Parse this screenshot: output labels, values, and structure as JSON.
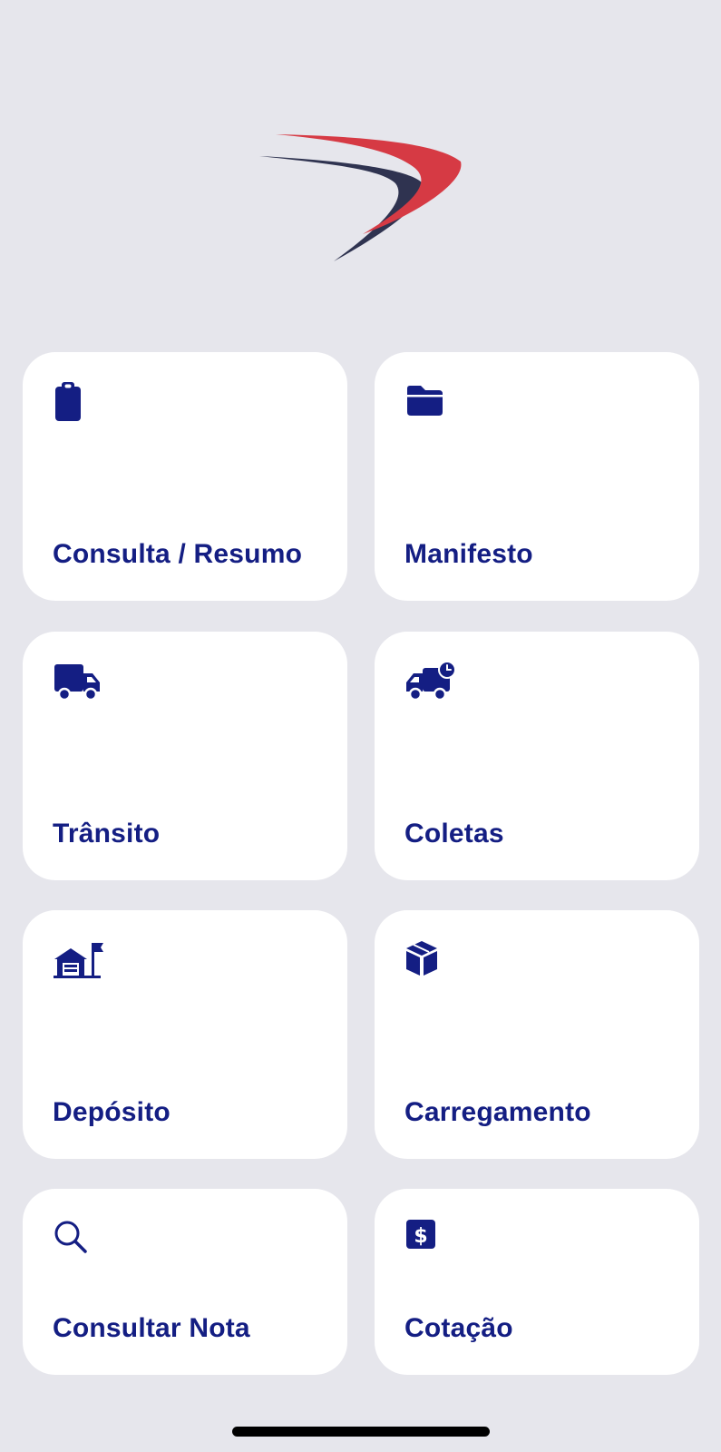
{
  "colors": {
    "background": "#e6e6ec",
    "card": "#ffffff",
    "accent": "#141e83",
    "logo_red": "#d63a44",
    "logo_navy": "#2f3350"
  },
  "logo": {
    "icon": "brand-swoosh-logo"
  },
  "menu": {
    "items": [
      {
        "label": "Consulta / Resumo",
        "icon": "clipboard-icon"
      },
      {
        "label": "Manifesto",
        "icon": "folder-icon"
      },
      {
        "label": "Trânsito",
        "icon": "truck-icon"
      },
      {
        "label": "Coletas",
        "icon": "truck-clock-icon"
      },
      {
        "label": "Depósito",
        "icon": "warehouse-flag-icon"
      },
      {
        "label": "Carregamento",
        "icon": "box-icon"
      },
      {
        "label": "Consultar Nota",
        "icon": "search-icon"
      },
      {
        "label": "Cotação",
        "icon": "dollar-sign-icon"
      }
    ]
  }
}
